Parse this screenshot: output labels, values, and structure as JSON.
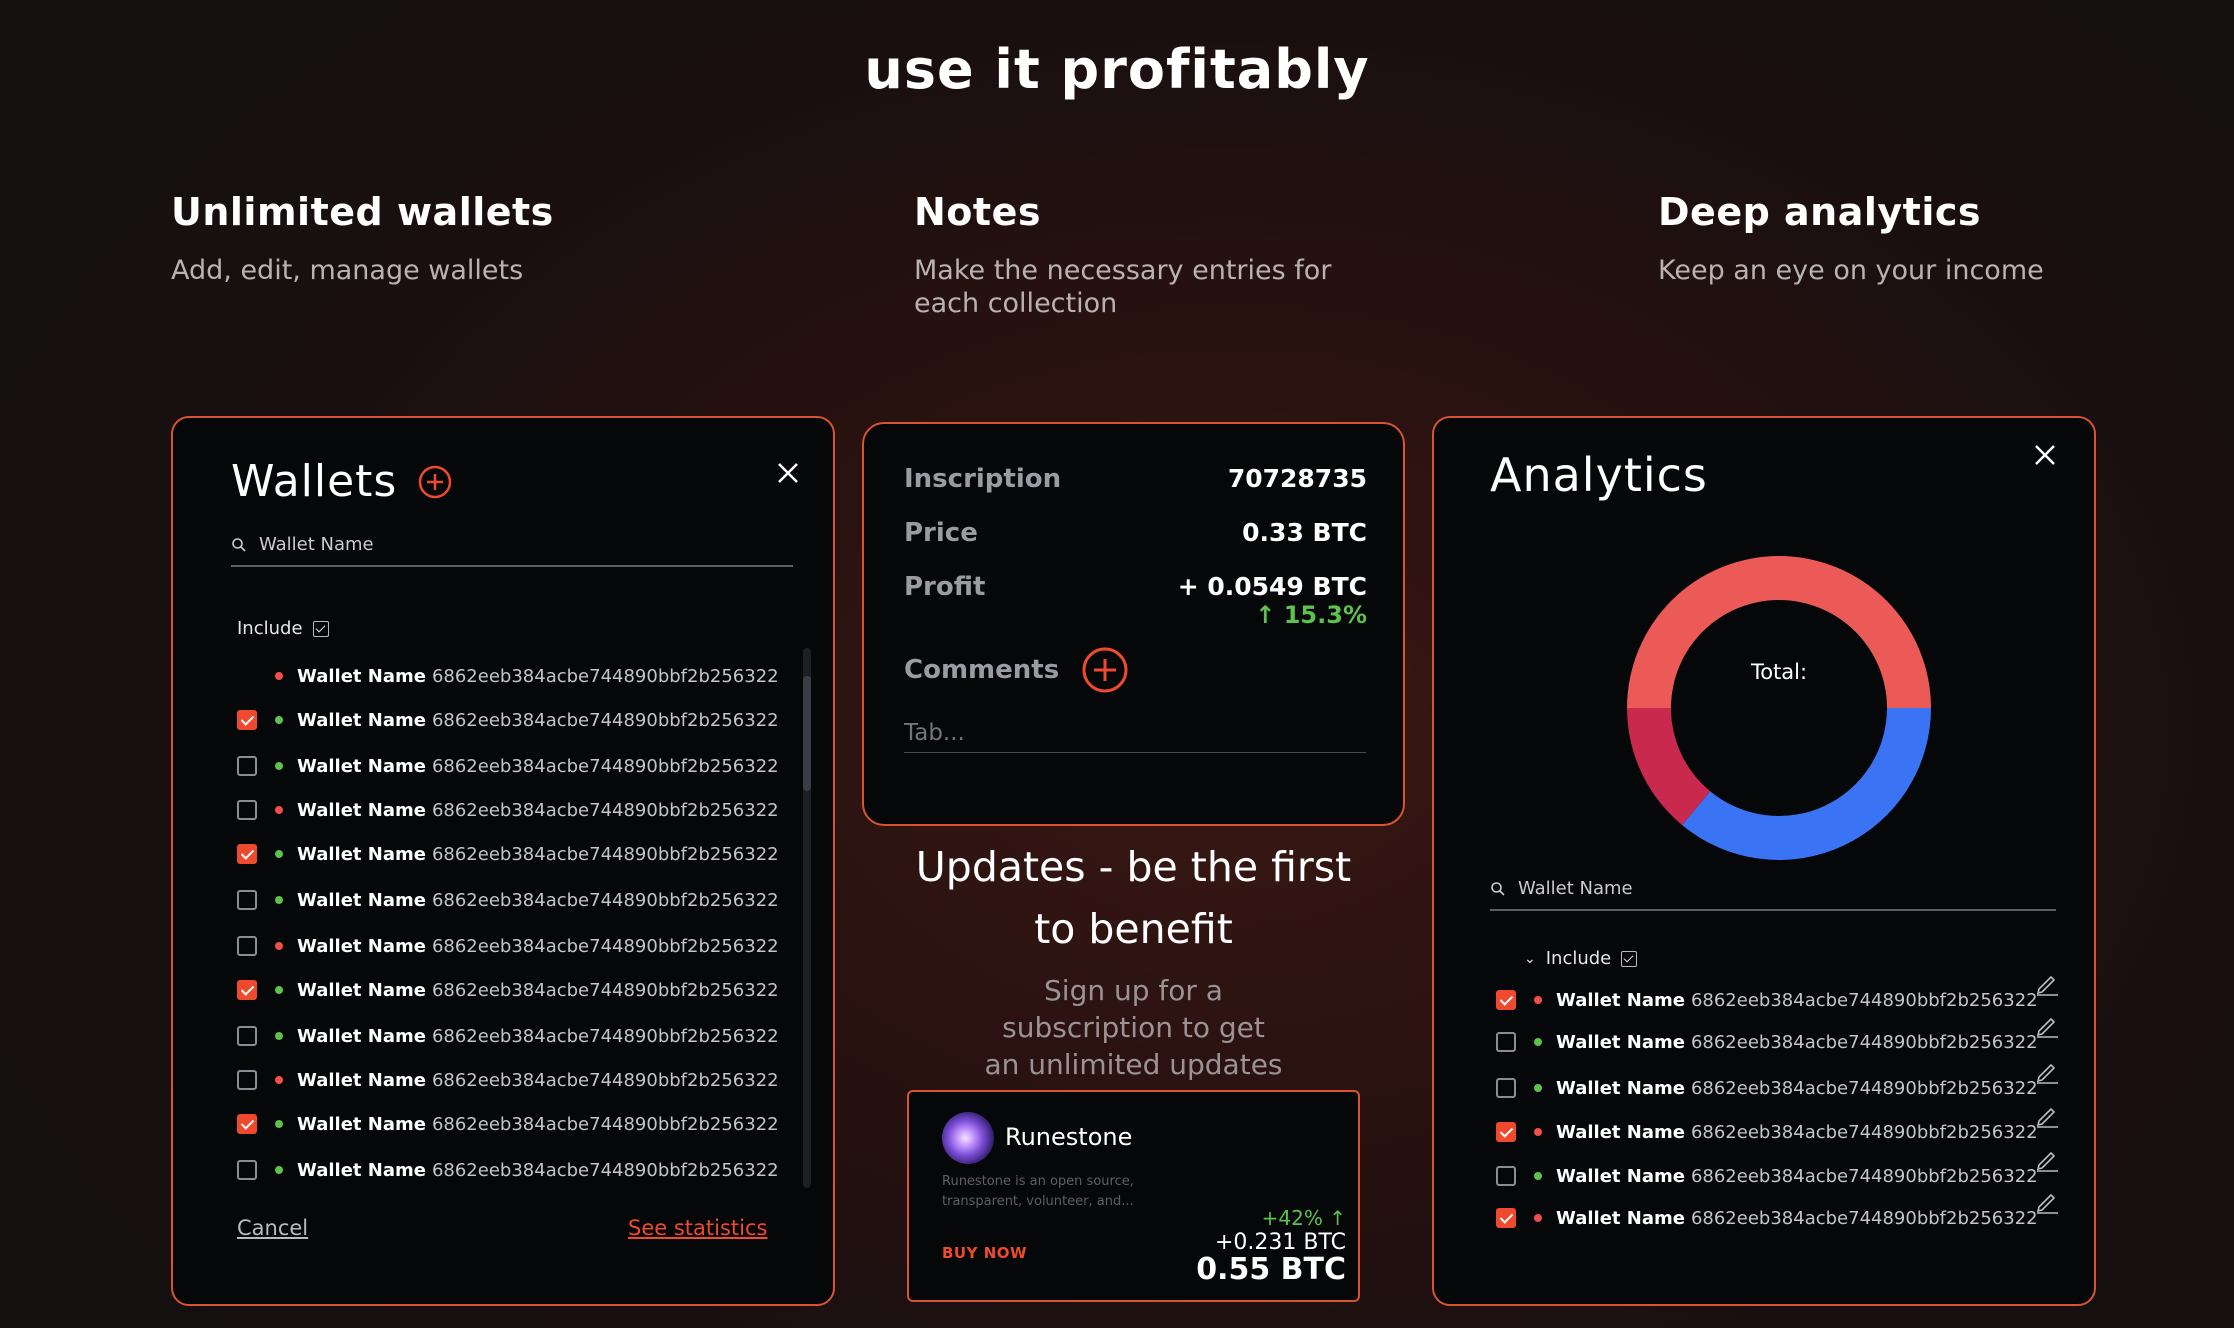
{
  "hero_title": "use it profitably",
  "features": [
    {
      "title": "Unlimited wallets",
      "desc": "Add, edit, manage wallets"
    },
    {
      "title": "Notes",
      "desc": "Make the necessary entries for each collection"
    },
    {
      "title": "Deep analytics",
      "desc": "Keep an eye on your income"
    }
  ],
  "wallets": {
    "title": "Wallets",
    "search_placeholder": "Wallet Name",
    "include_label": "Include",
    "rows": [
      {
        "name": "Wallet Name",
        "hash": "6862eeb384acbe744890bbf2b256322",
        "status": "red",
        "checked": "none"
      },
      {
        "name": "Wallet Name",
        "hash": "6862eeb384acbe744890bbf2b256322",
        "status": "green",
        "checked": "on"
      },
      {
        "name": "Wallet Name",
        "hash": "6862eeb384acbe744890bbf2b256322",
        "status": "green",
        "checked": "off"
      },
      {
        "name": "Wallet Name",
        "hash": "6862eeb384acbe744890bbf2b256322",
        "status": "red",
        "checked": "off"
      },
      {
        "name": "Wallet Name",
        "hash": "6862eeb384acbe744890bbf2b256322",
        "status": "green",
        "checked": "on"
      },
      {
        "name": "Wallet Name",
        "hash": "6862eeb384acbe744890bbf2b256322",
        "status": "green",
        "checked": "off"
      },
      {
        "name": "Wallet Name",
        "hash": "6862eeb384acbe744890bbf2b256322",
        "status": "red",
        "checked": "off"
      },
      {
        "name": "Wallet Name",
        "hash": "6862eeb384acbe744890bbf2b256322",
        "status": "green",
        "checked": "on"
      },
      {
        "name": "Wallet Name",
        "hash": "6862eeb384acbe744890bbf2b256322",
        "status": "green",
        "checked": "off"
      },
      {
        "name": "Wallet Name",
        "hash": "6862eeb384acbe744890bbf2b256322",
        "status": "red",
        "checked": "off"
      },
      {
        "name": "Wallet Name",
        "hash": "6862eeb384acbe744890bbf2b256322",
        "status": "green",
        "checked": "on"
      },
      {
        "name": "Wallet Name",
        "hash": "6862eeb384acbe744890bbf2b256322",
        "status": "green",
        "checked": "off"
      }
    ],
    "cancel_label": "Cancel",
    "stats_label": "See statistics"
  },
  "notes": {
    "inscription_label": "Inscription",
    "inscription_value": "70728735",
    "price_label": "Price",
    "price_value": "0.33 BTC",
    "profit_label": "Profit",
    "profit_value": "+ 0.0549 BTC",
    "profit_pct": "15.3%",
    "comments_label": "Comments",
    "comment_placeholder": "Tab..."
  },
  "updates": {
    "title_line1": "Updates - be the first",
    "title_line2": "to benefit",
    "sub_line1": "Sign up for a",
    "sub_line2": "subscription to get",
    "sub_line3": "an unlimited updates"
  },
  "runestone": {
    "name": "Runestone",
    "desc_line1": "Runestone is an open source,",
    "desc_line2": "transparent, volunteer, and...",
    "buy_label": "BUY NOW",
    "change_pct": "+42%",
    "change_btc": "+0.231 BTC",
    "price": "0.55 BTC"
  },
  "analytics": {
    "title": "Analytics",
    "total_label": "Total:",
    "search_placeholder": "Wallet Name",
    "include_label": "Include",
    "rows": [
      {
        "name": "Wallet Name",
        "hash": "6862eeb384acbe744890bbf2b256322",
        "status": "red",
        "checked": "on"
      },
      {
        "name": "Wallet Name",
        "hash": "6862eeb384acbe744890bbf2b256322",
        "status": "green",
        "checked": "off"
      },
      {
        "name": "Wallet Name",
        "hash": "6862eeb384acbe744890bbf2b256322",
        "status": "green",
        "checked": "off"
      },
      {
        "name": "Wallet Name",
        "hash": "6862eeb384acbe744890bbf2b256322",
        "status": "red",
        "checked": "on"
      },
      {
        "name": "Wallet Name",
        "hash": "6862eeb384acbe744890bbf2b256322",
        "status": "green",
        "checked": "off"
      },
      {
        "name": "Wallet Name",
        "hash": "6862eeb384acbe744890bbf2b256322",
        "status": "red",
        "checked": "on"
      }
    ],
    "donut_segments": [
      {
        "color": "#ec5a58",
        "value": 50
      },
      {
        "color": "#3a74f5",
        "value": 36
      },
      {
        "color": "#c8294d",
        "value": 14
      }
    ]
  },
  "colors": {
    "accent": "#ef4a2d",
    "red_status": "#f0504a",
    "green_status": "#5cc24b"
  }
}
